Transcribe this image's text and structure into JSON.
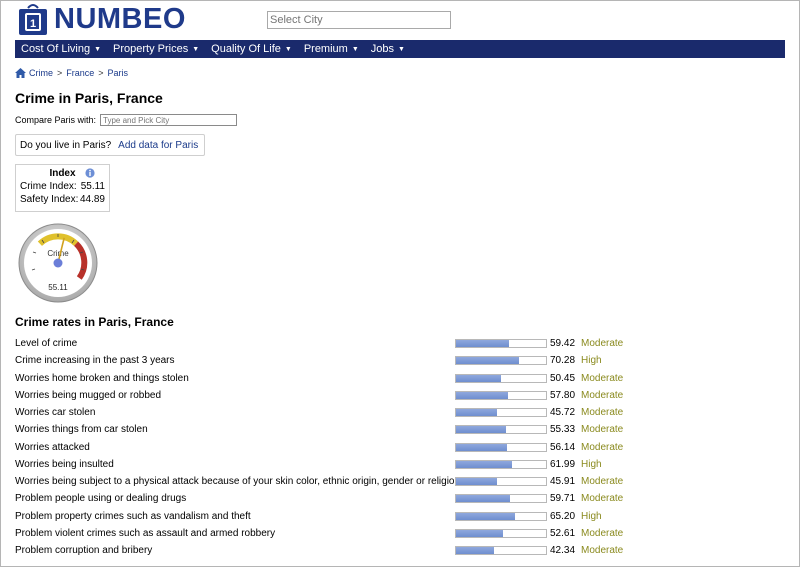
{
  "header": {
    "logo_text": "NUMBEO",
    "select_city_placeholder": "Select City"
  },
  "nav": [
    {
      "label": "Cost Of Living"
    },
    {
      "label": "Property Prices"
    },
    {
      "label": "Quality Of Life"
    },
    {
      "label": "Premium"
    },
    {
      "label": "Jobs"
    }
  ],
  "breadcrumb": {
    "items": [
      "Crime",
      "France",
      "Paris"
    ],
    "separator": ">"
  },
  "page": {
    "title": "Crime in Paris, France",
    "compare_label": "Compare Paris with:",
    "compare_placeholder": "Type and Pick City",
    "live_question": "Do you live in Paris?",
    "add_data_link": "Add data for Paris"
  },
  "index": {
    "heading": "Index",
    "crime_label": "Crime Index:",
    "crime_value": "55.11",
    "safety_label": "Safety Index:",
    "safety_value": "44.89"
  },
  "gauge": {
    "label": "Crime",
    "value_text": "55.11",
    "level": 55.11
  },
  "rates": {
    "title": "Crime rates in Paris, France",
    "rows": [
      {
        "label": "Level of crime",
        "value": "59.42",
        "level": "Moderate"
      },
      {
        "label": "Crime increasing in the past 3 years",
        "value": "70.28",
        "level": "High"
      },
      {
        "label": "Worries home broken and things stolen",
        "value": "50.45",
        "level": "Moderate"
      },
      {
        "label": "Worries being mugged or robbed",
        "value": "57.80",
        "level": "Moderate"
      },
      {
        "label": "Worries car stolen",
        "value": "45.72",
        "level": "Moderate"
      },
      {
        "label": "Worries things from car stolen",
        "value": "55.33",
        "level": "Moderate"
      },
      {
        "label": "Worries attacked",
        "value": "56.14",
        "level": "Moderate"
      },
      {
        "label": "Worries being insulted",
        "value": "61.99",
        "level": "High"
      },
      {
        "label": "Worries being subject to a physical attack because of your skin color, ethnic origin, gender or religion",
        "value": "45.91",
        "level": "Moderate"
      },
      {
        "label": "Problem people using or dealing drugs",
        "value": "59.71",
        "level": "Moderate"
      },
      {
        "label": "Problem property crimes such as vandalism and theft",
        "value": "65.20",
        "level": "High"
      },
      {
        "label": "Problem violent crimes such as assault and armed robbery",
        "value": "52.61",
        "level": "Moderate"
      },
      {
        "label": "Problem corruption and bribery",
        "value": "42.34",
        "level": "Moderate"
      }
    ]
  },
  "colors": {
    "nav_bg": "#1a2a6c",
    "logo": "#1f3a8a",
    "level_text": "#8a8a1e",
    "bar_fill": "#7f9ad6"
  }
}
